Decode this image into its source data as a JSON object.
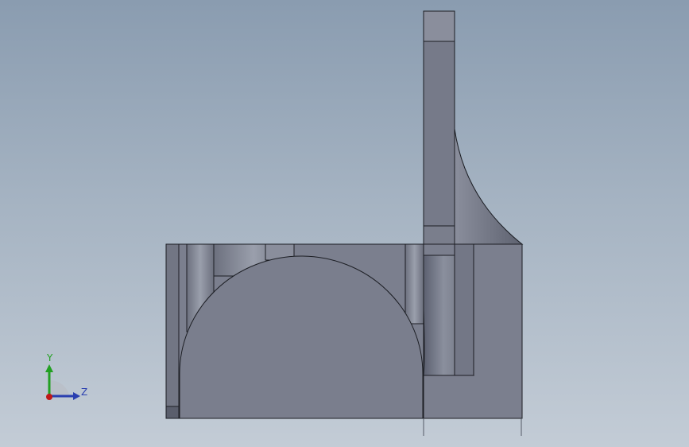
{
  "viewport": {
    "background_top": "#8a9cb0",
    "background_bottom": "#c3ccd6",
    "part_face_color": "#7c8090",
    "part_dark_color": "#5f6372",
    "part_light_color": "#9aa0ad",
    "edge_color": "#1c1e24"
  },
  "triad": {
    "y_label": "Y",
    "z_label": "Z",
    "y_color": "#22a022",
    "z_color": "#2a3fb0",
    "x_color": "#c01818"
  }
}
